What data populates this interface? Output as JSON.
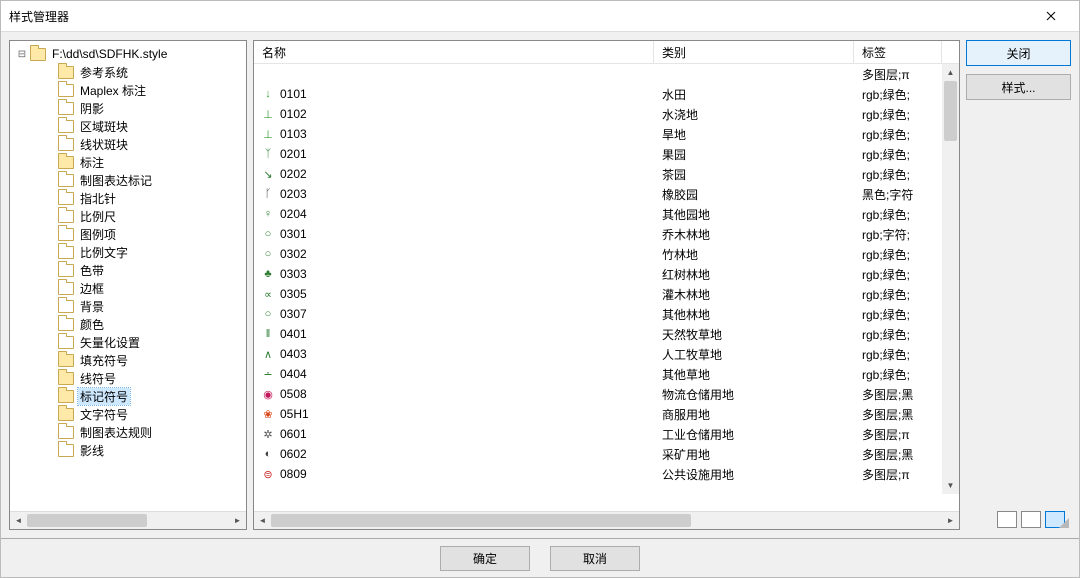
{
  "title": "样式管理器",
  "buttons": {
    "close": "关闭",
    "styles": "样式...",
    "ok": "确定",
    "cancel": "取消"
  },
  "tree": {
    "root": "F:\\dd\\sd\\SDFHK.style",
    "selected": "标记符号",
    "items": [
      {
        "label": "参考系统",
        "open": true
      },
      {
        "label": "Maplex 标注",
        "open": false
      },
      {
        "label": "阴影",
        "open": false
      },
      {
        "label": "区域斑块",
        "open": false
      },
      {
        "label": "线状斑块",
        "open": false
      },
      {
        "label": "标注",
        "open": true
      },
      {
        "label": "制图表达标记",
        "open": false
      },
      {
        "label": "指北针",
        "open": false
      },
      {
        "label": "比例尺",
        "open": false
      },
      {
        "label": "图例项",
        "open": false
      },
      {
        "label": "比例文字",
        "open": false
      },
      {
        "label": "色带",
        "open": false
      },
      {
        "label": "边框",
        "open": false
      },
      {
        "label": "背景",
        "open": false
      },
      {
        "label": "颜色",
        "open": false
      },
      {
        "label": "矢量化设置",
        "open": false
      },
      {
        "label": "填充符号",
        "open": true
      },
      {
        "label": "线符号",
        "open": true
      },
      {
        "label": "标记符号",
        "open": true
      },
      {
        "label": "文字符号",
        "open": true
      },
      {
        "label": "制图表达规则",
        "open": false
      },
      {
        "label": "影线",
        "open": false
      }
    ]
  },
  "columns": {
    "name": "名称",
    "category": "类别",
    "tags": "标签"
  },
  "rows": [
    {
      "sym": "↓",
      "sc": "#3a9d3a",
      "name": "0101",
      "cat": "水田",
      "tag": "rgb;绿色;"
    },
    {
      "sym": "⊥",
      "sc": "#3a9d3a",
      "name": "0102",
      "cat": "水浇地",
      "tag": "rgb;绿色;"
    },
    {
      "sym": "⊥",
      "sc": "#3a9d3a",
      "name": "0103",
      "cat": "旱地",
      "tag": "rgb;绿色;"
    },
    {
      "sym": "ᛉ",
      "sc": "#2e7d32",
      "name": "0201",
      "cat": "果园",
      "tag": "rgb;绿色;"
    },
    {
      "sym": "↘",
      "sc": "#2e7d32",
      "name": "0202",
      "cat": "茶园",
      "tag": "rgb;绿色;"
    },
    {
      "sym": "ᚴ",
      "sc": "#333",
      "name": "0203",
      "cat": "橡胶园",
      "tag": "黑色;字符"
    },
    {
      "sym": "♀",
      "sc": "#2e7d32",
      "name": "0204",
      "cat": "其他园地",
      "tag": "rgb;绿色;"
    },
    {
      "sym": "○",
      "sc": "#2e7d32",
      "name": "0301",
      "cat": "乔木林地",
      "tag": "rgb;字符;"
    },
    {
      "sym": "○",
      "sc": "#2e7d32",
      "name": "0302",
      "cat": "竹林地",
      "tag": "rgb;绿色;"
    },
    {
      "sym": "♣",
      "sc": "#2e7d32",
      "name": "0303",
      "cat": "红树林地",
      "tag": "rgb;绿色;"
    },
    {
      "sym": "∝",
      "sc": "#2e7d32",
      "name": "0305",
      "cat": "灌木林地",
      "tag": "rgb;绿色;"
    },
    {
      "sym": "○",
      "sc": "#2e7d32",
      "name": "0307",
      "cat": "其他林地",
      "tag": "rgb;绿色;"
    },
    {
      "sym": "‖",
      "sc": "#2e7d32",
      "name": "0401",
      "cat": "天然牧草地",
      "tag": "rgb;绿色;"
    },
    {
      "sym": "∧",
      "sc": "#2e7d32",
      "name": "0403",
      "cat": "人工牧草地",
      "tag": "rgb;绿色;"
    },
    {
      "sym": "∸",
      "sc": "#2e7d32",
      "name": "0404",
      "cat": "其他草地",
      "tag": "rgb;绿色;"
    },
    {
      "sym": "◉",
      "sc": "#c2185b",
      "name": "0508",
      "cat": "物流仓储用地",
      "tag": "多图层;黑"
    },
    {
      "sym": "❀",
      "sc": "#d84315",
      "name": "05H1",
      "cat": "商服用地",
      "tag": "多图层;黑"
    },
    {
      "sym": "✲",
      "sc": "#555",
      "name": "0601",
      "cat": "工业仓储用地",
      "tag": "多图层;π"
    },
    {
      "sym": "◐",
      "sc": "#444",
      "name": "0602",
      "cat": "采矿用地",
      "tag": "多图层;黑"
    },
    {
      "sym": "⊜",
      "sc": "#c62828",
      "name": "0809",
      "cat": "公共设施用地",
      "tag": "多图层;π"
    }
  ],
  "header_extra": "多图层;π"
}
